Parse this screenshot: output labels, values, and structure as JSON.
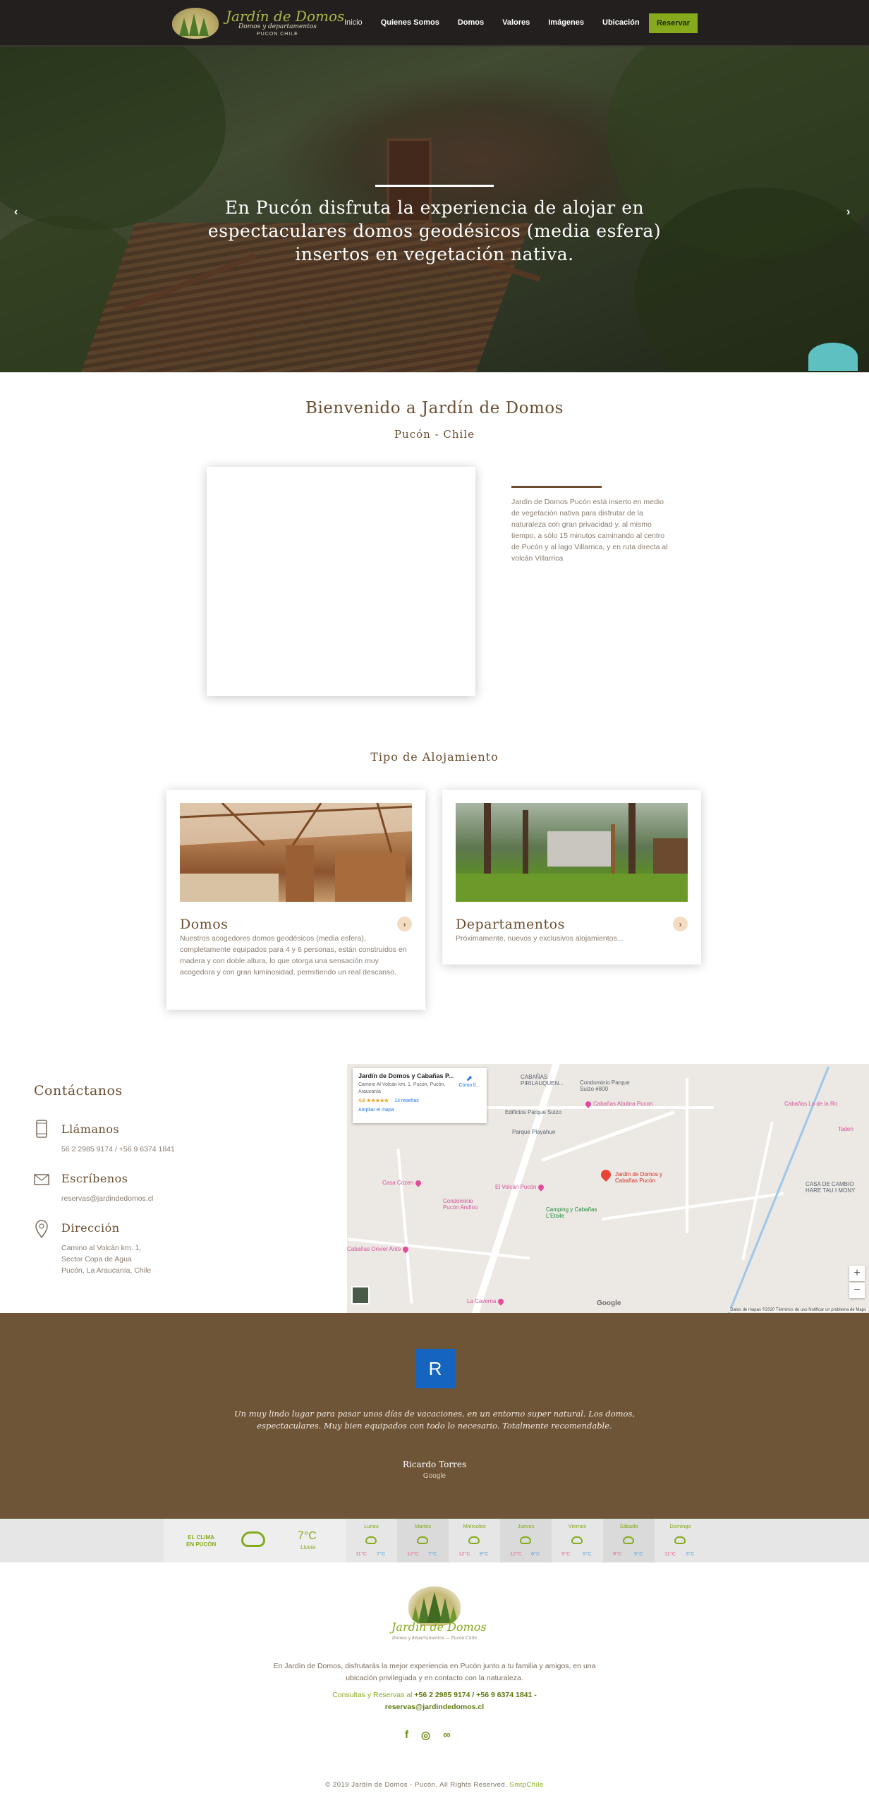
{
  "header": {
    "logo_title": "Jardín de Domos",
    "logo_subtitle": "Domos y departamentos",
    "logo_location": "PUCON CHILE",
    "nav": [
      "Inicio",
      "Quienes Somos",
      "Domos",
      "Valores",
      "Imágenes",
      "Ubicación"
    ],
    "reserve_label": "Reservar"
  },
  "hero": {
    "text": "En Pucón disfruta la experiencia de alojar en espectaculares domos geodésicos (media esfera) insertos en vegetación nativa.",
    "prev_icon": "‹",
    "next_icon": "›"
  },
  "welcome": {
    "title": "Bienvenido a Jardín de Domos",
    "subtitle": "Pucón - Chile",
    "text": "Jardín de Domos Pucón está inserto en medio de vegetación nativa para disfrutar de la naturaleza con gran privacidad y, al mismo tiempo, a sólo 15 minutos caminando al centro de Pucón y al lago Villarrica, y en ruta directa al volcán Villarrica"
  },
  "tipo": {
    "title": "Tipo de Alojamiento",
    "cards": [
      {
        "title": "Domos",
        "text": "Nuestros acogedores domos geodésicos (media esfera), completamente equipados para 4 y 6 personas, están construidos en madera y con doble altura, lo que otorga una sensación muy acogedora y con gran luminosidad, permitiendo un real descanso."
      },
      {
        "title": "Departamentos",
        "text": "Próximamente, nuevos y exclusivos alojamientos..."
      }
    ]
  },
  "contact": {
    "title": "Contáctanos",
    "phone_label": "Llámanos",
    "phone_value": "56 2 2985 9174 / +56 9 6374 1841",
    "email_label": "Escríbenos",
    "email_value": "reservas@jardindedomos.cl",
    "address_label": "Dirección",
    "address_lines": [
      "Camino al Volcán km. 1,",
      "Sector Copa de Agua",
      "Pucón, La Araucanía, Chile"
    ]
  },
  "map": {
    "info_title": "Jardín de Domos y Cabañas P...",
    "info_address": "Camino Al Volcán km. 1, Pucón, Pucón, Araucanía",
    "info_rating": "4,6 ★★★★★",
    "info_reviews": "13 reseñas",
    "info_link": "Ampliar el mapa",
    "info_directions": "Cómo ll...",
    "labels": {
      "cabanas": "CABAÑAS PIRILAUQUEN...",
      "condominio": "Condominio Parque Suizo #800",
      "abubra": "Cabañas Abubra Pucon",
      "lo_de_la": "Cabañas Lo de la Ro",
      "edificios": "Edificios Parque Suizo",
      "parque": "Parque Playahue",
      "casa_cozen": "Casa Cozen",
      "volcan_pucon": "El Volcán Pucón",
      "condominio_andino": "Condominio Pucón Andino",
      "main_pin": "Jardín de Domos y Cabañas Pucón",
      "camping": "Camping y Cabañas L'Etoile",
      "casa_cambio": "CASA DE CAMBIO HARE TAU I MONY",
      "taden": "Taden",
      "orivier": "Cabañas Orivier Anto",
      "caverna": "La Caverna",
      "google": "Google",
      "footer": "Datos de mapas ©2020   Términos de uso   Notificar un problema de Maps",
      "zoom_in": "+",
      "zoom_out": "−"
    }
  },
  "review": {
    "badge": "R",
    "text": "Un muy lindo lugar para pasar unos días de vacaciones, en un entorno super natural. Los domos, espectaculares. Muy bien equipados con todo lo necesario. Totalmente recomendable.",
    "name": "Ricardo Torres",
    "source": "Google"
  },
  "weather": {
    "label_line1": "EL CLIMA",
    "label_line2": "EN PUCÓN",
    "temp": "7°C",
    "condition": "Lluvia",
    "days": [
      {
        "name": "Lunes",
        "hi": "11°C",
        "lo": "7°C"
      },
      {
        "name": "Martes",
        "hi": "12°C",
        "lo": "7°C"
      },
      {
        "name": "Miércoles",
        "hi": "12°C",
        "lo": "8°C"
      },
      {
        "name": "Jueves",
        "hi": "12°C",
        "lo": "6°C"
      },
      {
        "name": "Viernes",
        "hi": "9°C",
        "lo": "5°C"
      },
      {
        "name": "Sábado",
        "hi": "9°C",
        "lo": "5°C"
      },
      {
        "name": "Domingo",
        "hi": "11°C",
        "lo": "3°C"
      }
    ]
  },
  "footer": {
    "logo_title": "Jardín de Domos",
    "logo_subtitle": "Domos y departamentos — Pucón Chile",
    "text": "En Jardín de Domos, disfrutarás la mejor experiencia en Pucón junto a tu familia y amigos, en una ubicación privilegiada y en contacto con la naturaleza.",
    "contact_prefix": "Consultas y Reservas al",
    "contact_phones": "+56 2 2985 9174 / +56 9 6374 1841 -",
    "contact_email": "reservas@jardindedomos.cl",
    "social": [
      "f",
      "◎",
      "∞"
    ],
    "copyright": "© 2019 Jardín de Domos - Pucón. All Rights Reserved.",
    "credit": "SmtpChile"
  },
  "colors": {
    "header_bg": "#231f1e",
    "accent_green": "#86aa1c",
    "brown": "#6b4e31",
    "review_bg": "#6e5538"
  }
}
